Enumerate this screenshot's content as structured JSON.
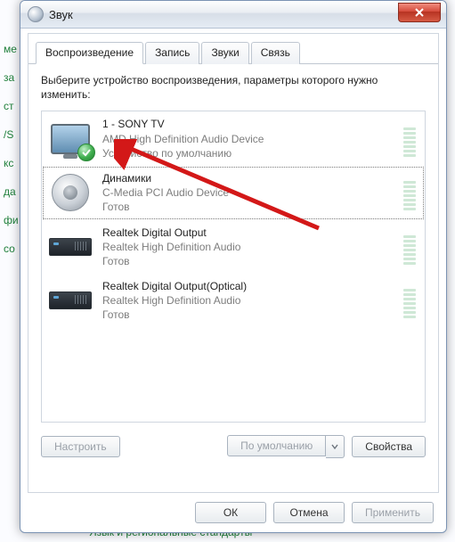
{
  "window": {
    "title": "Звук"
  },
  "tabs": [
    {
      "label": "Воспроизведение",
      "active": true
    },
    {
      "label": "Запись",
      "active": false
    },
    {
      "label": "Звуки",
      "active": false
    },
    {
      "label": "Связь",
      "active": false
    }
  ],
  "instruction": "Выберите устройство воспроизведения, параметры которого нужно изменить:",
  "devices": [
    {
      "name": "1 - SONY TV",
      "driver": "AMD High Definition Audio Device",
      "state": "Устройство по умолчанию",
      "icon": "tv",
      "default": true,
      "selected": false
    },
    {
      "name": "Динамики",
      "driver": "C-Media PCI Audio Device",
      "state": "Готов",
      "icon": "speaker",
      "default": false,
      "selected": true
    },
    {
      "name": "Realtek Digital Output",
      "driver": "Realtek High Definition Audio",
      "state": "Готов",
      "icon": "receiver",
      "default": false,
      "selected": false
    },
    {
      "name": "Realtek Digital Output(Optical)",
      "driver": "Realtek High Definition Audio",
      "state": "Готов",
      "icon": "receiver",
      "default": false,
      "selected": false
    }
  ],
  "panel_buttons": {
    "configure": "Настроить",
    "set_default": "По умолчанию",
    "properties": "Свойства"
  },
  "dialog_buttons": {
    "ok": "ОК",
    "cancel": "Отмена",
    "apply": "Применить"
  },
  "background": {
    "links": [
      "ме",
      "за",
      "ст",
      "/S",
      "кс",
      "да",
      "фи",
      "со"
    ],
    "bottom": "Язык и региональные стандарты"
  }
}
